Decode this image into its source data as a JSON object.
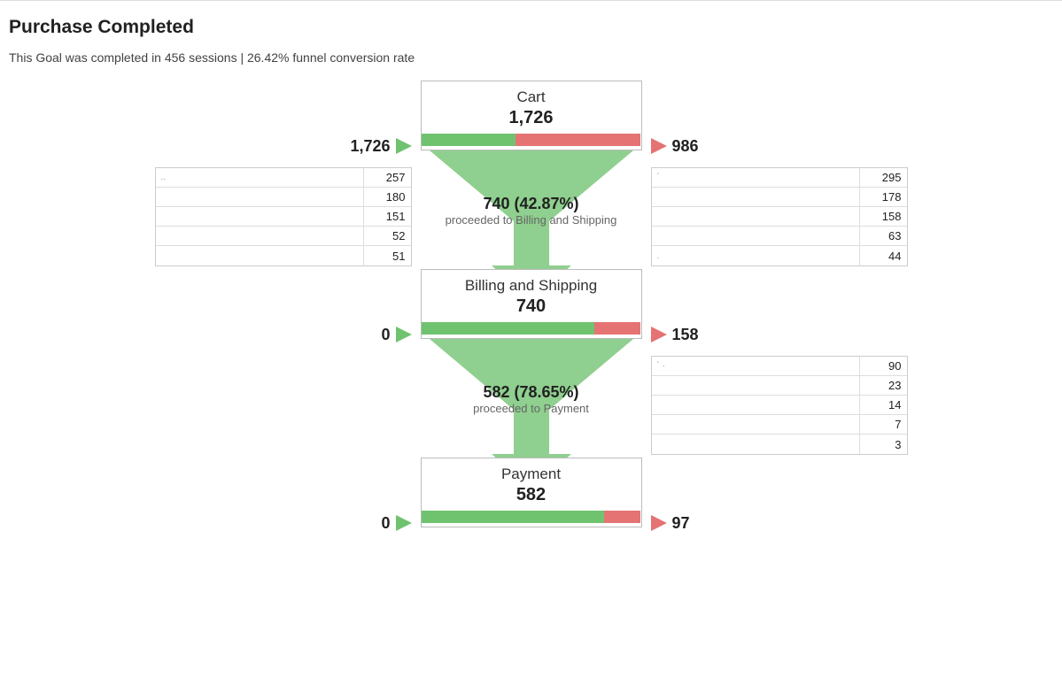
{
  "title": "Purchase Completed",
  "subtitle": "This Goal was completed in 456 sessions | 26.42% funnel conversion rate",
  "colors": {
    "green": "#6fc36f",
    "red": "#e57373",
    "arrow_in": "#6fc36f",
    "arrow_out": "#e57373"
  },
  "stages": [
    {
      "name": "Cart",
      "total": "1,726",
      "in_value": "1,726",
      "out_value": "986",
      "green_pct": 42.87,
      "proceed_main": "740 (42.87%)",
      "proceed_sub": "proceeded to Billing and Shipping",
      "left_rows": [
        "257",
        "180",
        "151",
        "52",
        "51"
      ],
      "right_rows": [
        "295",
        "178",
        "158",
        "63",
        "44"
      ]
    },
    {
      "name": "Billing and Shipping",
      "total": "740",
      "in_value": "0",
      "out_value": "158",
      "green_pct": 78.65,
      "proceed_main": "582 (78.65%)",
      "proceed_sub": "proceeded to Payment",
      "left_rows": [],
      "right_rows": [
        "90",
        "23",
        "14",
        "7",
        "3"
      ]
    },
    {
      "name": "Payment",
      "total": "582",
      "in_value": "0",
      "out_value": "97",
      "green_pct": 83.33,
      "proceed_main": "",
      "proceed_sub": "",
      "left_rows": [],
      "right_rows": []
    }
  ],
  "chart_data": {
    "type": "table",
    "title": "Purchase Completed funnel",
    "description": "Goal completed in 456 sessions, 26.42% funnel conversion rate",
    "steps": [
      {
        "step": "Cart",
        "sessions": 1726,
        "dropoff": 986,
        "proceeded": 740,
        "proceed_rate_pct": 42.87,
        "inflow_sources_top5": [
          257,
          180,
          151,
          52,
          51
        ],
        "outflow_destinations_top5": [
          295,
          178,
          158,
          63,
          44
        ]
      },
      {
        "step": "Billing and Shipping",
        "sessions": 740,
        "dropoff": 158,
        "proceeded": 582,
        "proceed_rate_pct": 78.65,
        "inflow_sources_top5": [],
        "outflow_destinations_top5": [
          90,
          23,
          14,
          7,
          3
        ]
      },
      {
        "step": "Payment",
        "sessions": 582,
        "dropoff": 97
      }
    ]
  }
}
